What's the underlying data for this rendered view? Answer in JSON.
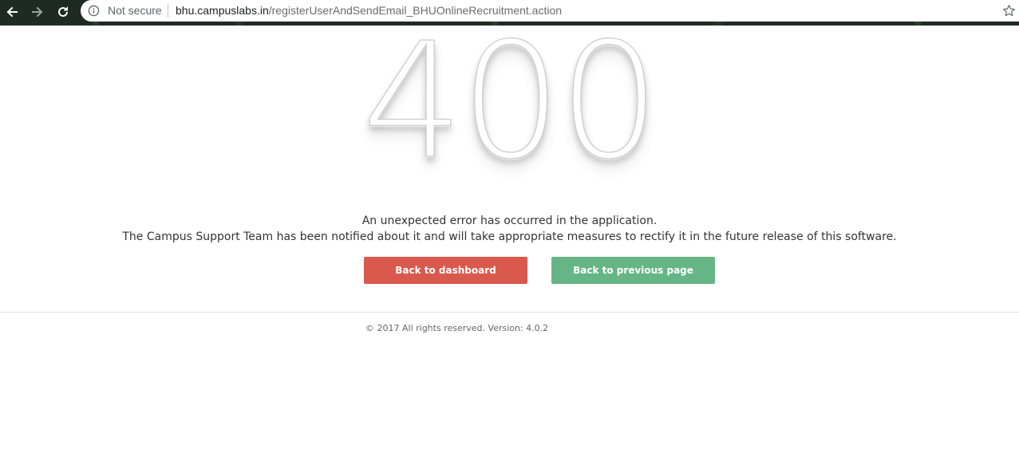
{
  "browser": {
    "nav_buttons": [
      "back-icon",
      "forward-icon",
      "reload-icon"
    ],
    "security_label": "Not secure",
    "url_host": "bhu.campuslabs.in",
    "url_path": "/registerUserAndSendEmail_BHUOnlineRecruitment.action",
    "bookmark_icon": "star-icon"
  },
  "error": {
    "code": "400",
    "message_line1": "An unexpected error has occurred in the application.",
    "message_line2": "The Campus Support Team has been notified about it and will take appropriate measures to rectify it in the future release of this software."
  },
  "actions": {
    "dashboard_label": "Back to dashboard",
    "previous_label": "Back to previous page",
    "dashboard_color": "#d9594c",
    "previous_color": "#66b587"
  },
  "footer": {
    "text": "© 2017  All rights reserved. Version: 4.0.2"
  }
}
